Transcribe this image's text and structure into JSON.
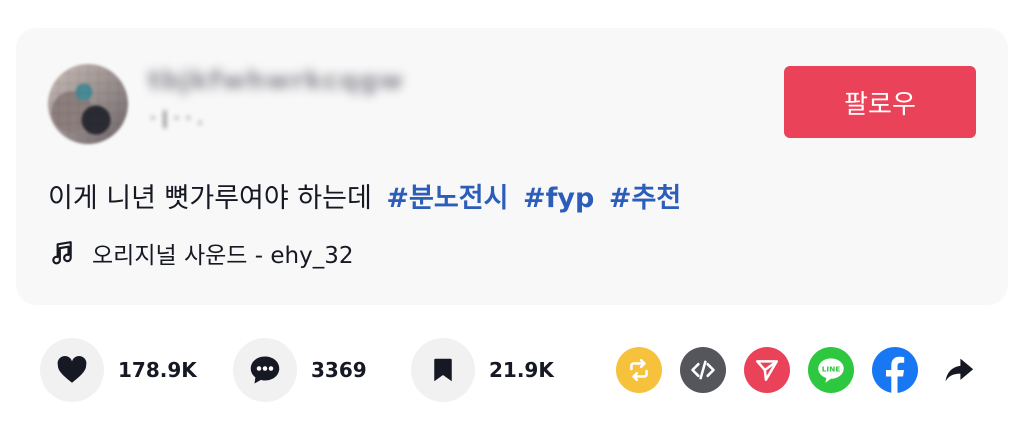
{
  "post": {
    "username": "tbjkfwhwrkcqgw",
    "nickname": "·|··.",
    "follow_label": "팔로우",
    "caption_text": "이게 니년 뼛가루여야 하는데",
    "hashtags": [
      "#분노전시",
      "#fyp",
      "#추천"
    ],
    "music_label": "오리지널 사운드 - ehy_32"
  },
  "actions": {
    "likes": "178.9K",
    "comments": "3369",
    "saves": "21.9K"
  },
  "share_icons": [
    "repost-icon",
    "embed-icon",
    "send-icon",
    "line-icon",
    "facebook-icon",
    "share-arrow-icon"
  ],
  "colors": {
    "follow": "#ea4359",
    "hashtag": "#2b5db9",
    "repost": "#f7c23b",
    "embed": "#54565c",
    "send": "#ea4359",
    "line": "#2dc83f",
    "facebook": "#1877f2"
  }
}
